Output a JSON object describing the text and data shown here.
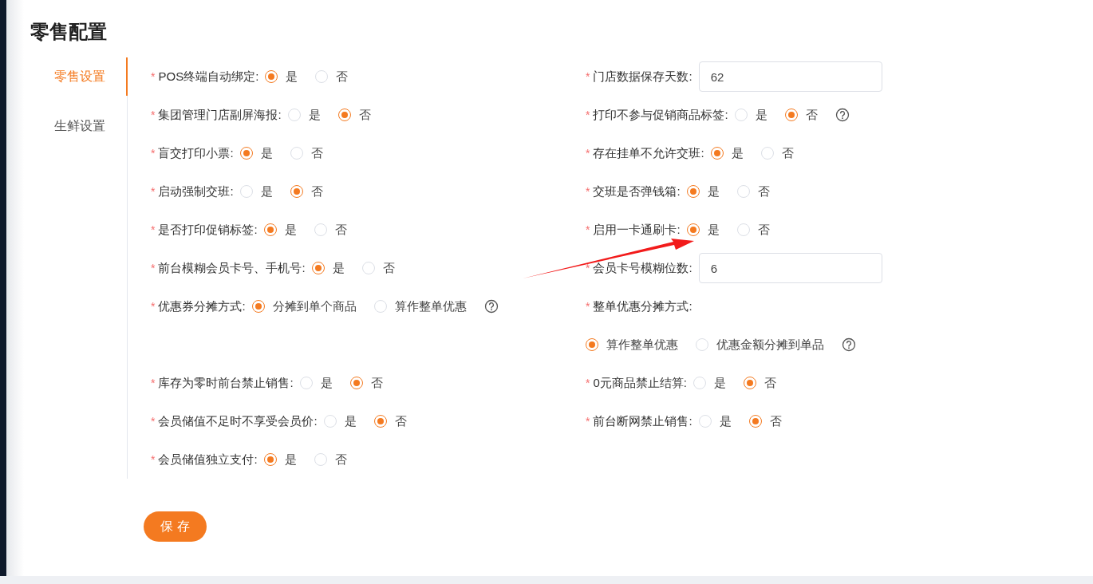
{
  "title": "零售配置",
  "tabs": [
    {
      "label": "零售设置",
      "selected": true
    },
    {
      "label": "生鲜设置",
      "selected": false
    }
  ],
  "rows": [
    {
      "left": {
        "kind": "radio",
        "asterisk": "*",
        "label": "POS终端自动绑定:",
        "options": [
          {
            "label": "是",
            "selected": true
          },
          {
            "label": "否",
            "selected": false
          }
        ]
      },
      "right": {
        "kind": "input",
        "asterisk": "*",
        "label": "门店数据保存天数:",
        "value": "62"
      }
    },
    {
      "left": {
        "kind": "radio",
        "asterisk": "*",
        "label": "集团管理门店副屏海报:",
        "options": [
          {
            "label": "是",
            "selected": false
          },
          {
            "label": "否",
            "selected": true
          }
        ]
      },
      "right": {
        "kind": "radio",
        "asterisk": "*",
        "label": "打印不参与促销商品标签:",
        "help": true,
        "options": [
          {
            "label": "是",
            "selected": false
          },
          {
            "label": "否",
            "selected": true
          }
        ]
      }
    },
    {
      "left": {
        "kind": "radio",
        "asterisk": "*",
        "label": "盲交打印小票:",
        "options": [
          {
            "label": "是",
            "selected": true
          },
          {
            "label": "否",
            "selected": false
          }
        ]
      },
      "right": {
        "kind": "radio",
        "asterisk": "*",
        "label": "存在挂单不允许交班:",
        "options": [
          {
            "label": "是",
            "selected": true
          },
          {
            "label": "否",
            "selected": false
          }
        ]
      }
    },
    {
      "left": {
        "kind": "radio",
        "asterisk": "*",
        "label": "启动强制交班:",
        "options": [
          {
            "label": "是",
            "selected": false
          },
          {
            "label": "否",
            "selected": true
          }
        ]
      },
      "right": {
        "kind": "radio",
        "asterisk": "*",
        "label": "交班是否弹钱箱:",
        "options": [
          {
            "label": "是",
            "selected": true
          },
          {
            "label": "否",
            "selected": false
          }
        ]
      }
    },
    {
      "left": {
        "kind": "radio",
        "asterisk": "*",
        "label": "是否打印促销标签:",
        "options": [
          {
            "label": "是",
            "selected": true
          },
          {
            "label": "否",
            "selected": false
          }
        ]
      },
      "right": {
        "kind": "radio",
        "asterisk": "*",
        "label": "启用一卡通刷卡:",
        "options": [
          {
            "label": "是",
            "selected": true
          },
          {
            "label": "否",
            "selected": false
          }
        ]
      }
    },
    {
      "left": {
        "kind": "radio",
        "asterisk": "*",
        "label": "前台模糊会员卡号、手机号:",
        "options": [
          {
            "label": "是",
            "selected": true
          },
          {
            "label": "否",
            "selected": false
          }
        ]
      },
      "right": {
        "kind": "input",
        "asterisk": "*",
        "label": "会员卡号模糊位数:",
        "value": "6"
      }
    },
    {
      "left": {
        "kind": "radio",
        "asterisk": "*",
        "label": "优惠券分摊方式:",
        "help": true,
        "options": [
          {
            "label": "分摊到单个商品",
            "selected": true
          },
          {
            "label": "算作整单优惠",
            "selected": false
          }
        ]
      },
      "right": {
        "kind": "radio-stacked",
        "asterisk": "*",
        "label": "整单优惠分摊方式:",
        "help": true,
        "options": [
          {
            "label": "算作整单优惠",
            "selected": true
          },
          {
            "label": "优惠金额分摊到单品",
            "selected": false
          }
        ]
      }
    },
    {
      "left": {
        "kind": "radio",
        "asterisk": "*",
        "label": "库存为零时前台禁止销售:",
        "options": [
          {
            "label": "是",
            "selected": false
          },
          {
            "label": "否",
            "selected": true
          }
        ]
      },
      "right": {
        "kind": "radio",
        "asterisk": "*",
        "label": "0元商品禁止结算:",
        "options": [
          {
            "label": "是",
            "selected": false
          },
          {
            "label": "否",
            "selected": true
          }
        ]
      }
    },
    {
      "left": {
        "kind": "radio",
        "asterisk": "*",
        "label": "会员储值不足时不享受会员价:",
        "options": [
          {
            "label": "是",
            "selected": false
          },
          {
            "label": "否",
            "selected": true
          }
        ]
      },
      "right": {
        "kind": "radio",
        "asterisk": "*",
        "label": "前台断网禁止销售:",
        "options": [
          {
            "label": "是",
            "selected": false
          },
          {
            "label": "否",
            "selected": true
          }
        ]
      }
    },
    {
      "left": {
        "kind": "radio",
        "asterisk": "*",
        "label": "会员储值独立支付:",
        "options": [
          {
            "label": "是",
            "selected": true
          },
          {
            "label": "否",
            "selected": false
          }
        ]
      }
    }
  ],
  "save_button": "保 存"
}
